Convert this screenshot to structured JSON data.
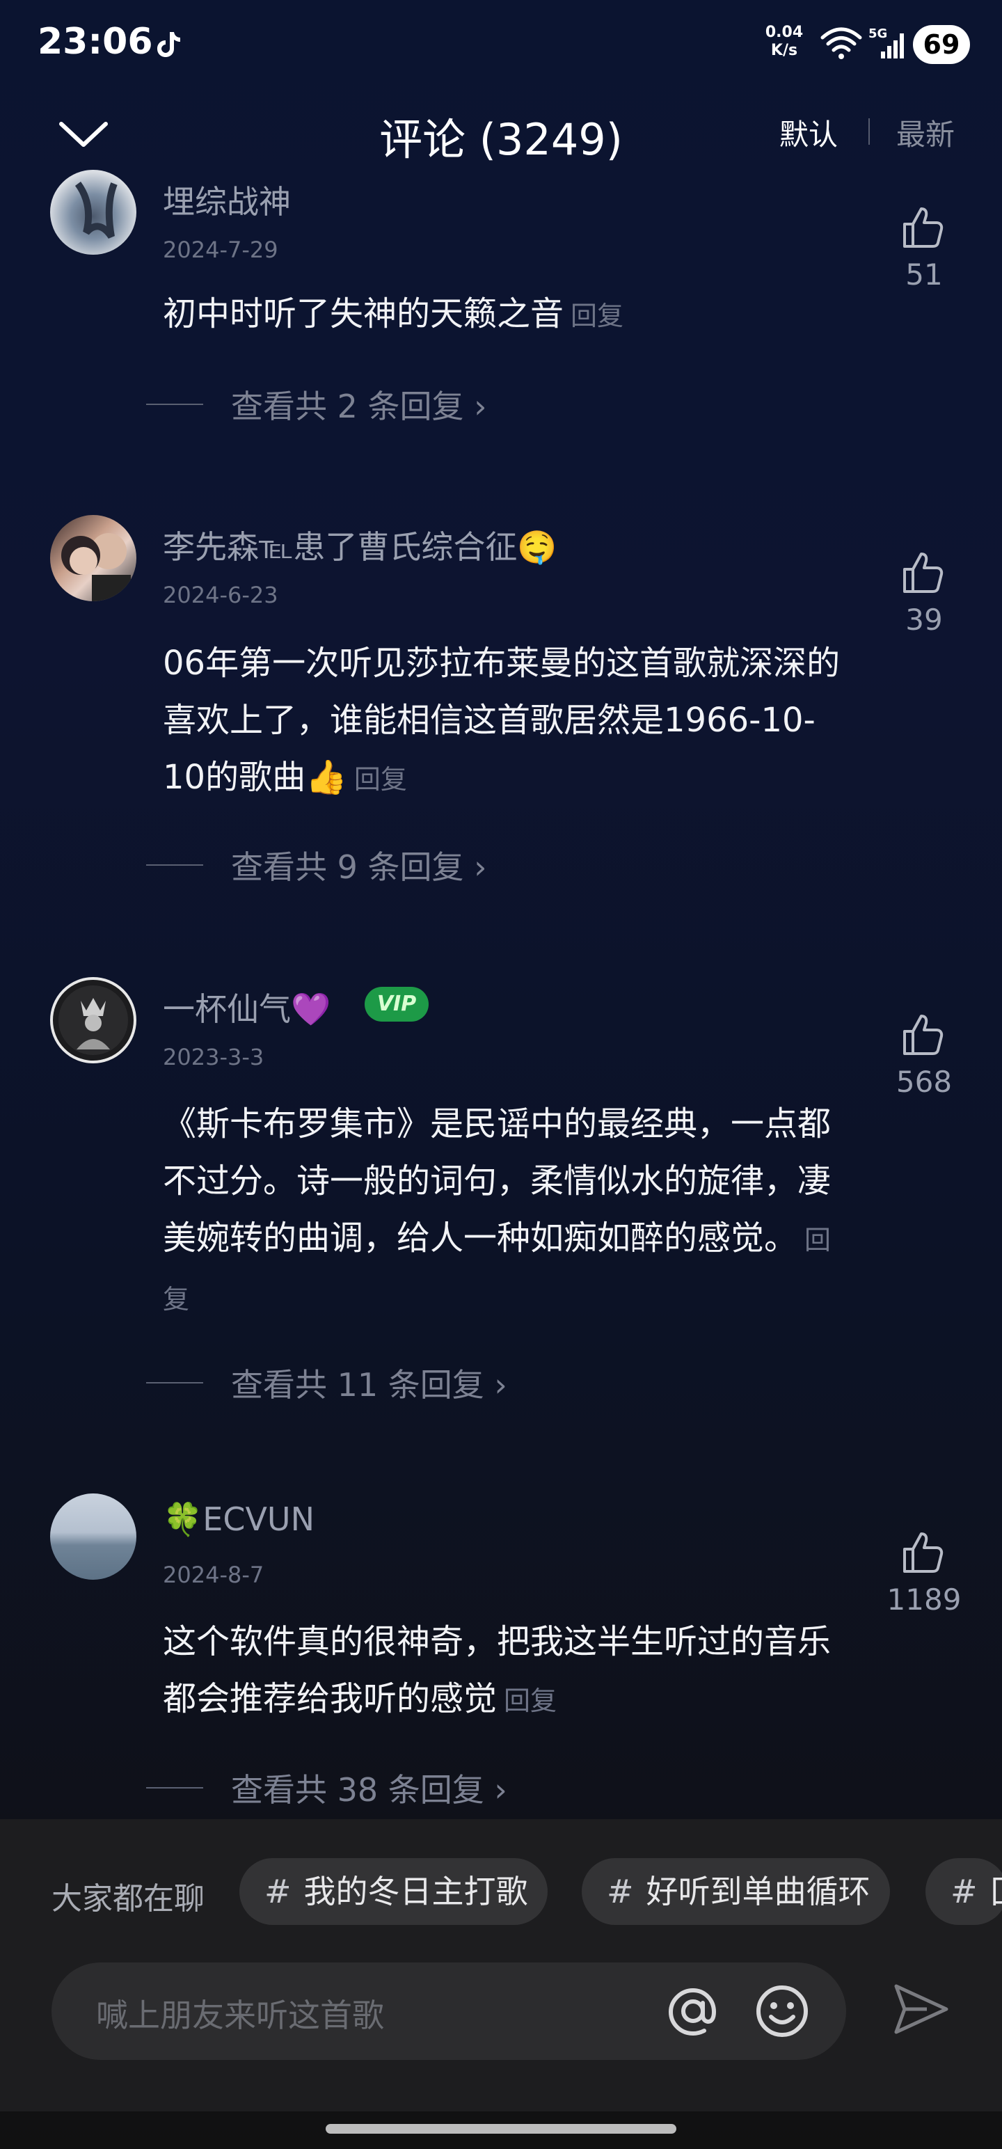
{
  "status_bar": {
    "time": "23:06",
    "net_speed_value": "0.04",
    "net_speed_unit": "K/s",
    "battery": "69",
    "icons": [
      "tiktok-icon",
      "wifi-icon",
      "signal-5g-icon",
      "battery-icon"
    ]
  },
  "header": {
    "title": "评论 (3249)",
    "sort_default": "默认",
    "sort_latest": "最新"
  },
  "comments": [
    {
      "username": "埋综战神",
      "date": "2024-7-29",
      "content": "初中时听了失神的天籁之音",
      "reply_label": "回复",
      "likes": "51",
      "view_replies": "查看共 2 条回复 ›"
    },
    {
      "username": "李先森℡患了曹氏综合征🤤",
      "date": "2024-6-23",
      "content": "06年第一次听见莎拉布莱曼的这首歌就深深的喜欢上了，谁能相信这首歌居然是1966-10-10的歌曲👍",
      "reply_label": "回复",
      "likes": "39",
      "view_replies": "查看共 9 条回复 ›"
    },
    {
      "username": "一杯仙气💜",
      "badge": "VIP",
      "date": "2023-3-3",
      "content": "《斯卡布罗集市》是民谣中的最经典，一点都不过分。诗一般的词句，柔情似水的旋律，凄美婉转的曲调，给人一种如痴如醉的感觉。",
      "reply_label": "回复",
      "likes": "568",
      "view_replies": "查看共 11 条回复 ›"
    },
    {
      "username": "🍀ECVUN",
      "date": "2024-8-7",
      "content": "这个软件真的很神奇，把我这半生听过的音乐都会推荐给我听的感觉",
      "reply_label": "回复",
      "likes": "1189",
      "view_replies": "查看共 38 条回复 ›"
    }
  ],
  "bottom": {
    "chat_label": "大家都在聊",
    "topics": [
      "我的冬日主打歌",
      "好听到单曲循环",
      "囗"
    ],
    "hash": "#",
    "input_placeholder": "喊上朋友来听这首歌"
  },
  "colors": {
    "background_top": "#0b1430",
    "panel": "#1d1d1f",
    "vip_green": "#1d9a47",
    "muted_text": "#9aa0b0"
  }
}
